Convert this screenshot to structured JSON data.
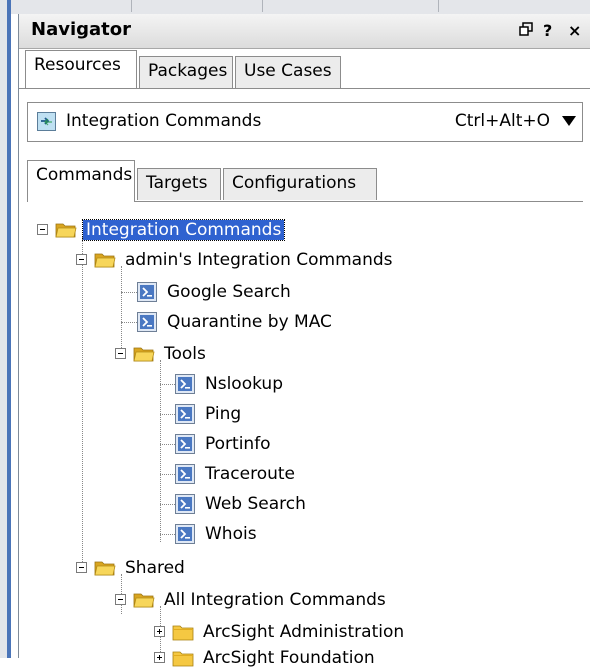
{
  "panel": {
    "title": "Navigator",
    "title_icons": [
      "restore-icon",
      "help-icon",
      "close-icon"
    ],
    "help_glyph": "?",
    "close_glyph": "×"
  },
  "outer_tabs": [
    {
      "label": "Resources",
      "active": true
    },
    {
      "label": "Packages",
      "active": false
    },
    {
      "label": "Use Cases",
      "active": false
    }
  ],
  "resource_selector": {
    "label": "Integration Commands",
    "shortcut": "Ctrl+Alt+O"
  },
  "inner_tabs": [
    {
      "label": "Commands",
      "active": true
    },
    {
      "label": "Targets",
      "active": false
    },
    {
      "label": "Configurations",
      "active": false
    }
  ],
  "tree": {
    "root": {
      "label": "Integration Commands",
      "selected": true
    },
    "admin_group": {
      "label": "admin's Integration Commands"
    },
    "google_search": {
      "label": "Google Search"
    },
    "quarantine": {
      "label": "Quarantine by MAC"
    },
    "tools": {
      "label": "Tools"
    },
    "tools_items": [
      "Nslookup",
      "Ping",
      "Portinfo",
      "Traceroute",
      "Web Search",
      "Whois"
    ],
    "shared": {
      "label": "Shared"
    },
    "all_commands": {
      "label": "All Integration Commands"
    },
    "arcsight_admin": {
      "label": "ArcSight Administration"
    },
    "arcsight_foundation": {
      "label": "ArcSight Foundation"
    }
  },
  "colors": {
    "selection": "#2f62d0",
    "folder": "#f5c842",
    "command_icon": "#4a78c2"
  }
}
